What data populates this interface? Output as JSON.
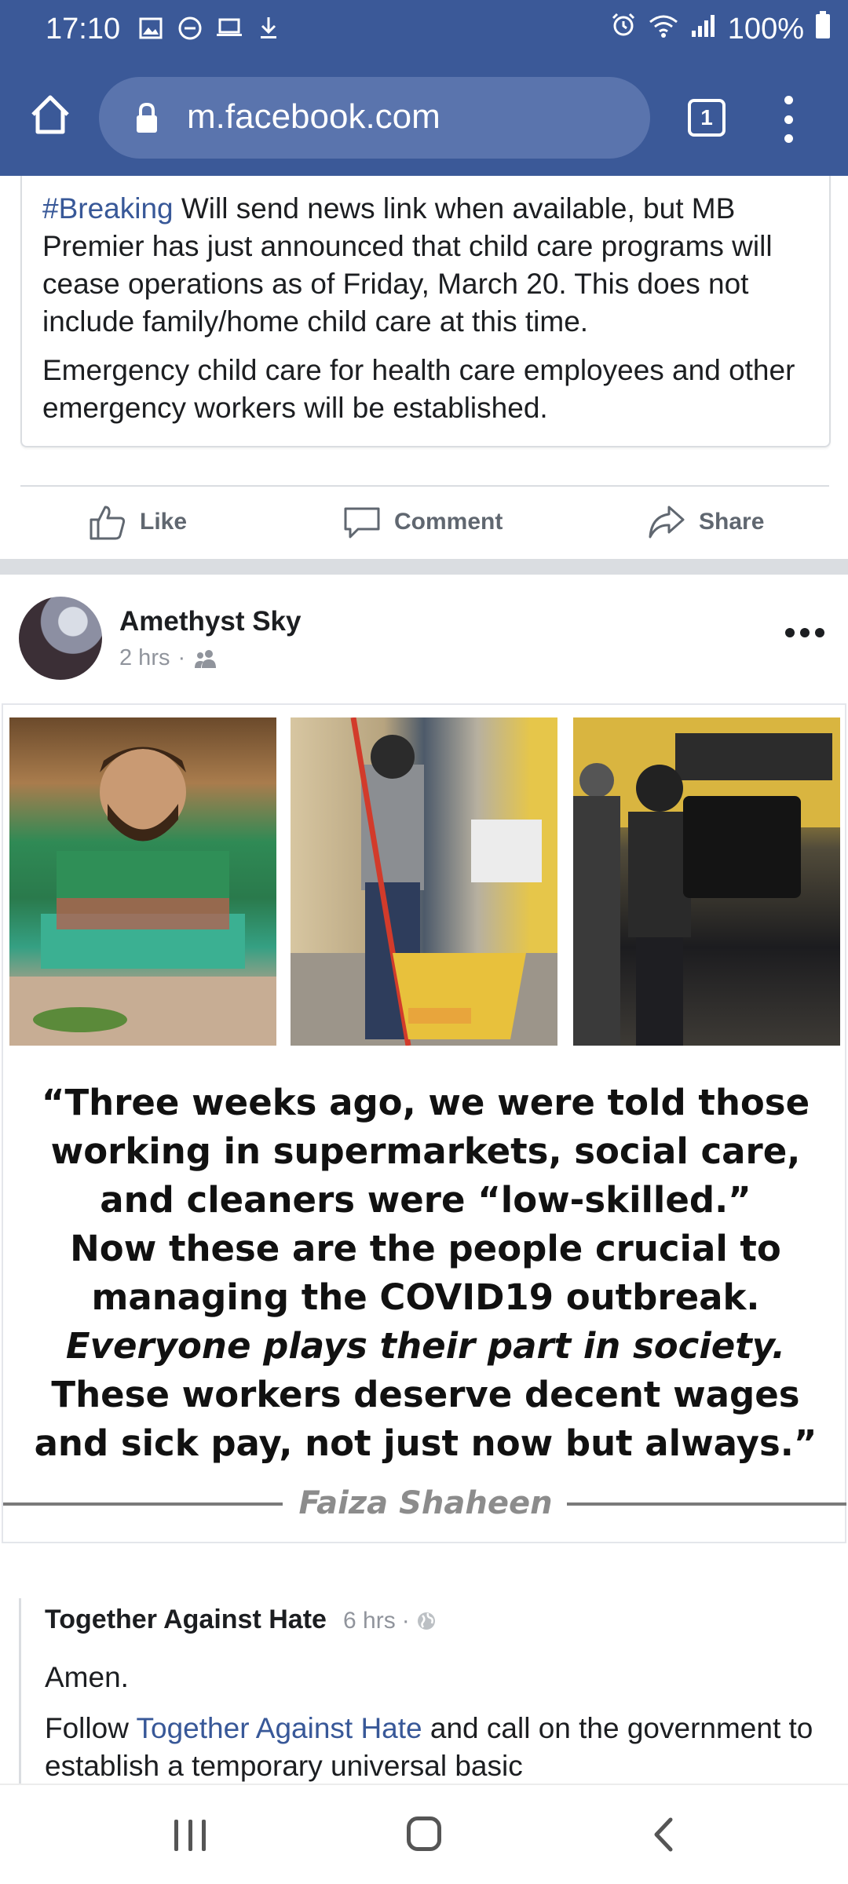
{
  "status_bar": {
    "time": "17:10",
    "battery": "100%",
    "left_icons": [
      "image-icon",
      "dnd-icon",
      "laptop-icon",
      "download-icon"
    ],
    "right_icons": [
      "alarm-icon",
      "wifi-icon",
      "signal-icon",
      "battery-icon"
    ]
  },
  "browser": {
    "url": "m.facebook.com",
    "tab_count": "1",
    "accent_color": "#3b5998"
  },
  "shared_post": {
    "hashtag": "#Breaking",
    "text1": " Will send news link when available, but MB Premier has just announced that child care programs will cease operations as of Friday, March 20. This does not include family/home child care at this time.",
    "text2": "Emergency child care for health care employees and other emergency workers will be established."
  },
  "actions": {
    "like": "Like",
    "comment": "Comment",
    "share": "Share"
  },
  "post": {
    "author": "Amethyst Sky",
    "time": "2 hrs",
    "separator": "·",
    "audience_icon": "friends-icon",
    "image": {
      "quote_line1": "“Three weeks ago, we were told those",
      "quote_line2": "working in supermarkets, social care,",
      "quote_line3": "and cleaners were “low-skilled.”",
      "quote_line4": "Now these are the people crucial to",
      "quote_line5": "managing the COVID19 outbreak.",
      "quote_line6": "Everyone plays their part in society.",
      "quote_line7": "These workers deserve decent wages",
      "quote_line8": "and sick pay, not just now but always.”",
      "attribution": "Faiza Shaheen"
    }
  },
  "comment": {
    "author": "Together Against Hate",
    "time": "6 hrs",
    "separator": "·",
    "audience_icon": "globe-icon",
    "amen": "Amen.",
    "follow_prefix": "Follow ",
    "follow_link": "Together Against Hate",
    "follow_suffix": " and call on the government to establish a temporary universal basic"
  }
}
